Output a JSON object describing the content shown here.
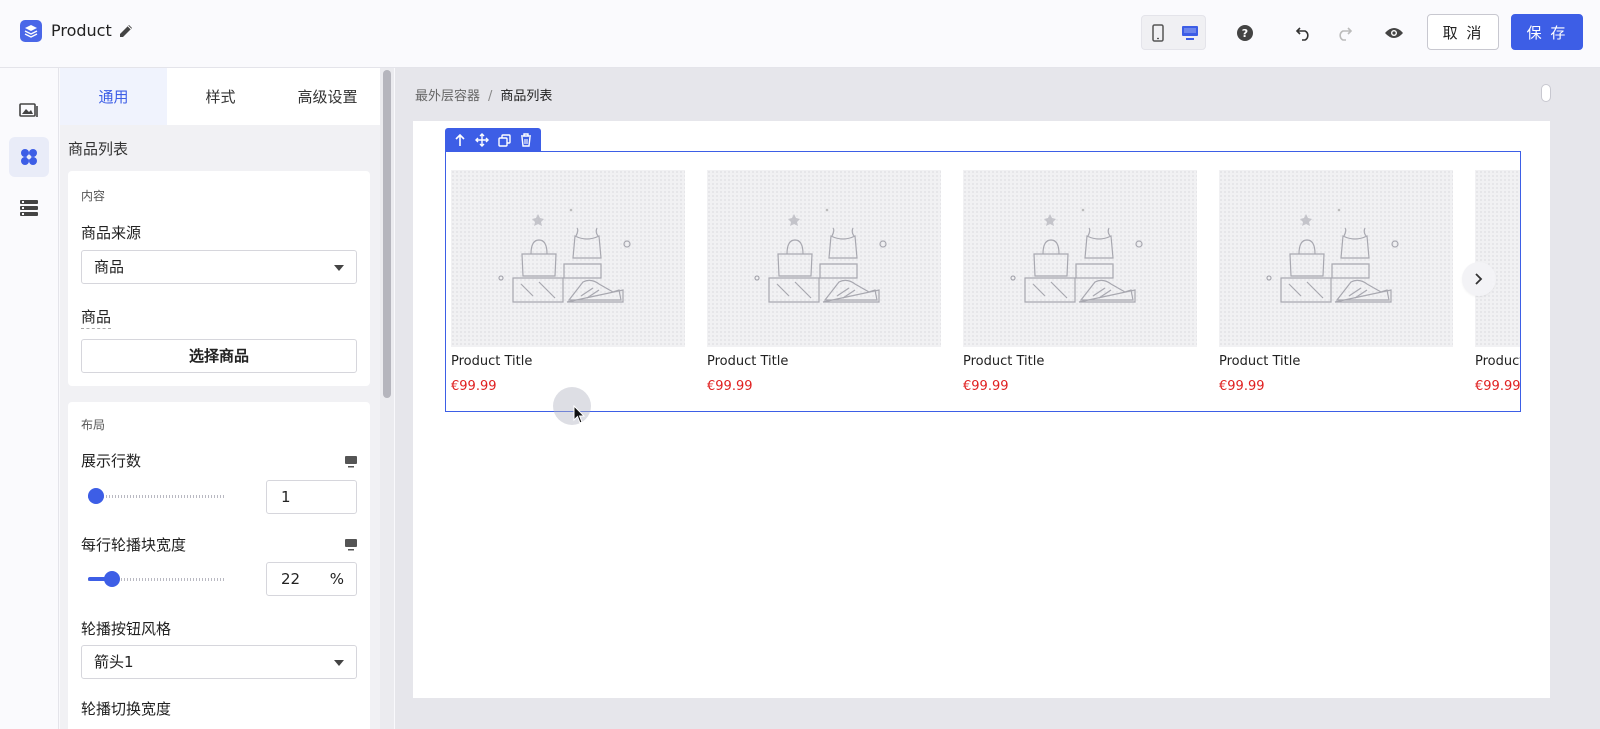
{
  "header": {
    "title": "Product",
    "edit_icon": "pencil-icon",
    "device_modes": [
      "mobile-icon",
      "desktop-icon"
    ],
    "active_device": "desktop",
    "actions": [
      "help-icon",
      "undo-icon",
      "redo-icon",
      "eye-icon"
    ],
    "cancel_label": "取 消",
    "save_label": "保 存"
  },
  "rail": {
    "items": [
      {
        "icon": "image-gallery-icon",
        "active": false
      },
      {
        "icon": "components-icon",
        "active": true
      },
      {
        "icon": "layers-icon",
        "active": false
      }
    ]
  },
  "panel": {
    "tabs": [
      {
        "label": "通用",
        "active": true
      },
      {
        "label": "样式",
        "active": false
      },
      {
        "label": "高级设置",
        "active": false
      }
    ],
    "section_title": "商品列表",
    "content": {
      "heading": "内容",
      "source_label": "商品来源",
      "source_value": "商品",
      "product_label": "商品",
      "select_button": "选择商品"
    },
    "layout": {
      "heading": "布局",
      "rows_label": "展示行数",
      "rows_value": "1",
      "rows_slider_fraction": 0.0,
      "width_label": "每行轮播块宽度",
      "width_value": "22",
      "width_unit": "%",
      "width_slider_fraction": 0.13,
      "button_style_label": "轮播按钮风格",
      "button_style_value": "箭头1",
      "switch_width_label": "轮播切换宽度"
    }
  },
  "canvas": {
    "breadcrumb": {
      "root": "最外层容器",
      "separator": "/",
      "current": "商品列表"
    },
    "toolbar": [
      "arrow-up-icon",
      "move-icon",
      "copy-icon",
      "trash-icon"
    ],
    "products": [
      {
        "title": "Product Title",
        "price": "€99.99"
      },
      {
        "title": "Product Title",
        "price": "€99.99"
      },
      {
        "title": "Product Title",
        "price": "€99.99"
      },
      {
        "title": "Product Title",
        "price": "€99.99"
      },
      {
        "title": "Product Title",
        "price": "€99.99"
      }
    ],
    "next_arrow": "chevron-right-icon"
  },
  "colors": {
    "accent": "#3d5ee6",
    "price": "#e02020",
    "canvas_bg": "#e6e6eb"
  }
}
